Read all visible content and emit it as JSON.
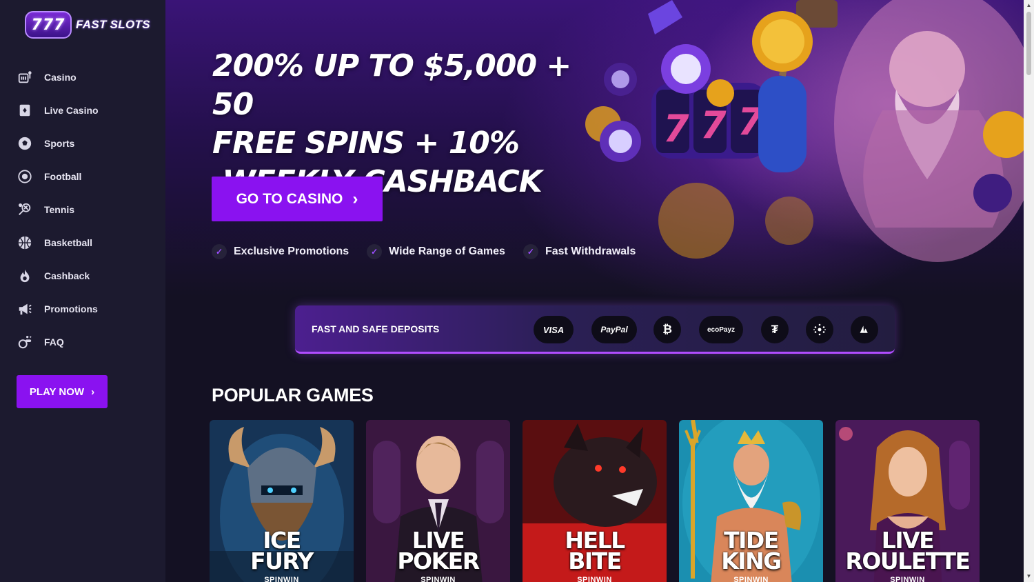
{
  "brand": {
    "badge": "777",
    "name": "FAST SLOTS"
  },
  "sidebar": {
    "items": [
      {
        "label": "Casino",
        "icon": "casino-icon"
      },
      {
        "label": "Live Casino",
        "icon": "live-casino-icon"
      },
      {
        "label": "Sports",
        "icon": "sports-icon"
      },
      {
        "label": "Football",
        "icon": "football-icon"
      },
      {
        "label": "Tennis",
        "icon": "tennis-icon"
      },
      {
        "label": "Basketball",
        "icon": "basketball-icon"
      },
      {
        "label": "Cashback",
        "icon": "cashback-icon"
      },
      {
        "label": "Promotions",
        "icon": "promotions-icon"
      },
      {
        "label": "FAQ",
        "icon": "faq-icon"
      }
    ],
    "play_label": "PLAY NOW"
  },
  "hero": {
    "title_lines": [
      "200% UP TO $5,000 + 50",
      "FREE SPINS + 10%",
      " WEEKLY CASHBACK"
    ],
    "cta_label": "GO TO CASINO",
    "features": [
      "Exclusive Promotions",
      "Wide Range of Games",
      "Fast Withdrawals"
    ]
  },
  "deposits": {
    "title": "FAST AND SAFE DEPOSITS",
    "methods": [
      {
        "label": "VISA",
        "icon": "visa-icon"
      },
      {
        "label": "PayPal",
        "icon": "paypal-icon"
      },
      {
        "label": "₿",
        "icon": "bitcoin-icon"
      },
      {
        "label": "ecoPayz",
        "icon": "ecopayz-icon"
      },
      {
        "label": "₮",
        "icon": "tether-icon"
      },
      {
        "label": "",
        "icon": "cardano-icon"
      },
      {
        "label": "",
        "icon": "avalanche-icon"
      }
    ]
  },
  "popular": {
    "title": "POPULAR GAMES",
    "games": [
      {
        "line1": "ICE",
        "line2": "FURY",
        "provider": "SPINWIN"
      },
      {
        "line1": "LIVE",
        "line2": "POKER",
        "provider": "SPINWIN"
      },
      {
        "line1": "HELL",
        "line2": "BITE",
        "provider": "SPINWIN"
      },
      {
        "line1": "TIDE",
        "line2": "KING",
        "provider": "SPINWIN"
      },
      {
        "line1": "LIVE",
        "line2": "ROULETTE",
        "provider": "SPINWIN"
      }
    ]
  },
  "colors": {
    "accent": "#8a12f0",
    "sidebar": "#1c1a2f",
    "background": "#141123"
  }
}
